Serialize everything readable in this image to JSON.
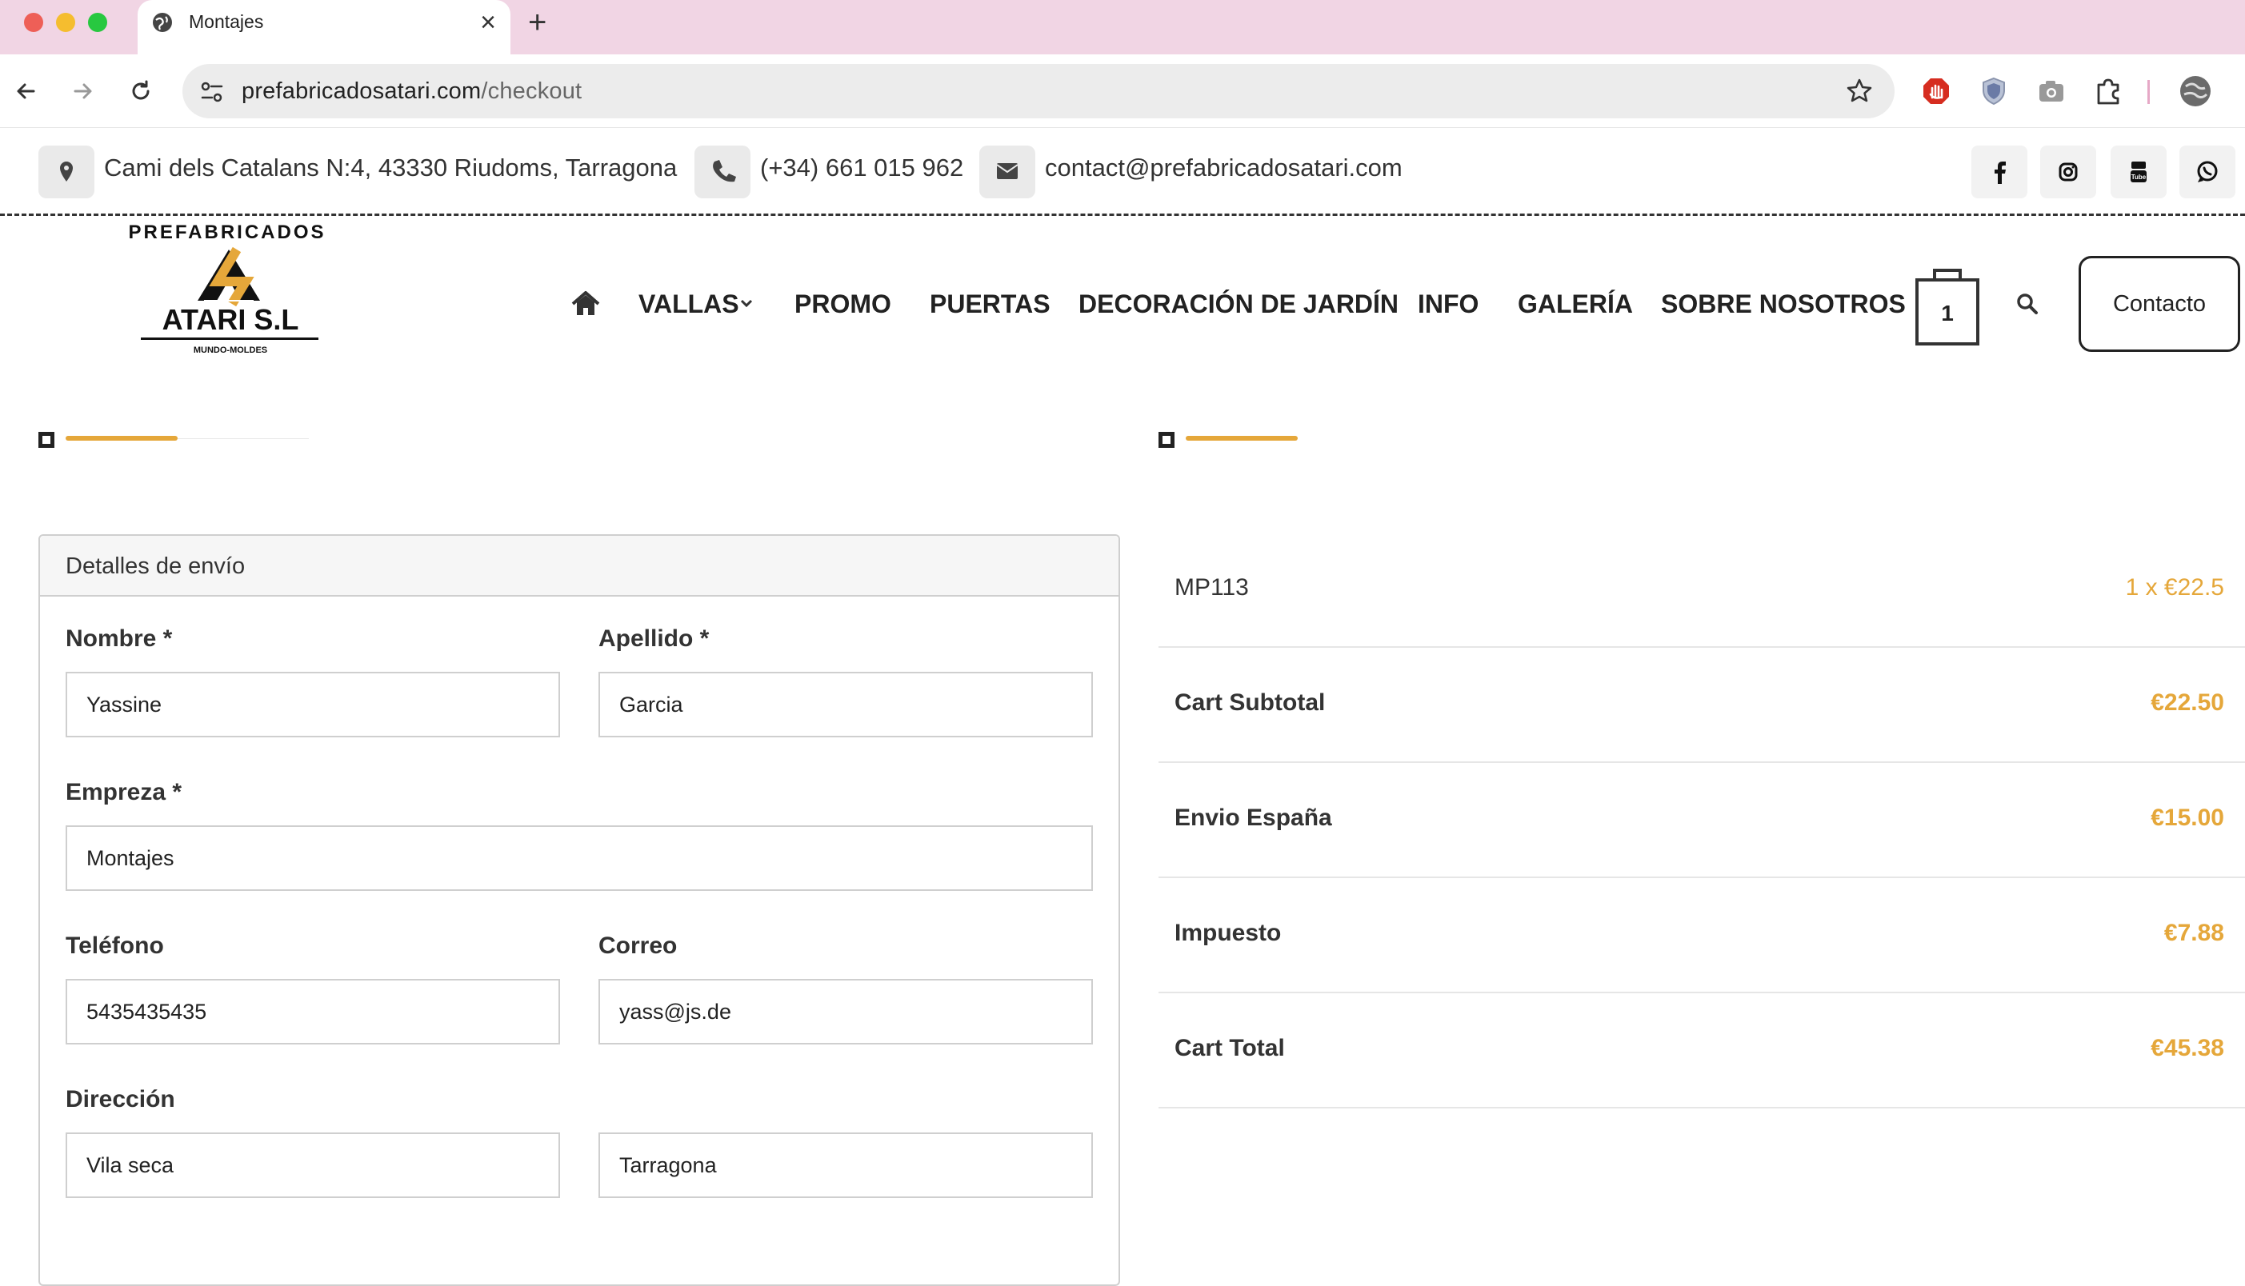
{
  "browser": {
    "tab_title": "Montajes",
    "url_domain": "prefabricadosatari.com",
    "url_path": "/checkout"
  },
  "topbar": {
    "address": "Cami dels Catalans N:4, 43330 Riudoms, Tarragona",
    "phone": "(+34) 661 015 962",
    "email": "contact@prefabricadosatari.com"
  },
  "logo": {
    "top_text": "PREFABRICADOS",
    "name": "ATARI S.L",
    "sub": "MUNDO-MOLDES"
  },
  "menu": {
    "items": [
      "VALLAS",
      "PROMO",
      "PUERTAS",
      "DECORACIÓN DE JARDÍN",
      "INFO",
      "GALERÍA",
      "SOBRE NOSOTROS"
    ],
    "cart_count": "1",
    "contact_label": "Contacto"
  },
  "form": {
    "title": "Detalles de envío",
    "nombre_label": "Nombre *",
    "nombre": "Yassine",
    "apellido_label": "Apellido *",
    "apellido": "Garcia",
    "empresa_label": "Empreza *",
    "empresa": "Montajes",
    "telefono_label": "Teléfono",
    "telefono": "5435435435",
    "correo_label": "Correo",
    "correo": "yass@js.de",
    "direccion_label": "Dirección",
    "direccion1": "Vila seca",
    "direccion2": "Tarragona"
  },
  "summary": {
    "rows": [
      {
        "label": "MP113",
        "value": "1 x €22.5"
      },
      {
        "label": "Cart Subtotal",
        "value": "€22.50"
      },
      {
        "label": "Envio España",
        "value": "€15.00"
      },
      {
        "label": "Impuesto",
        "value": "€7.88"
      },
      {
        "label": "Cart Total",
        "value": "€45.38"
      }
    ]
  },
  "colors": {
    "accent": "#e5a73a",
    "tabbar": "#f1d5e4",
    "text": "#222222"
  }
}
